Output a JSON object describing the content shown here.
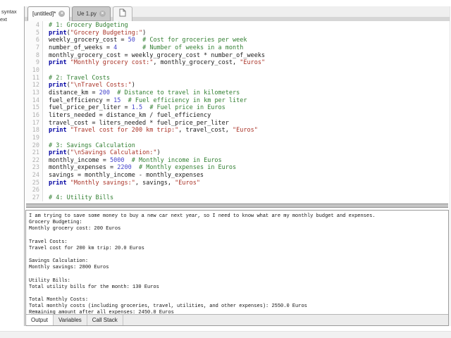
{
  "page": {
    "left_margin_labels": [
      "syntax",
      "ext"
    ]
  },
  "icons": {
    "close_glyph": "×"
  },
  "editor": {
    "tabs": [
      {
        "label": "[untitled]*",
        "active": true
      },
      {
        "label": "Ue 1.py",
        "active": false
      }
    ],
    "lines": [
      {
        "n": "4",
        "tokens": [
          [
            "c",
            "# 1: Grocery Budgeting"
          ]
        ]
      },
      {
        "n": "5",
        "tokens": [
          [
            "k",
            "print"
          ],
          [
            "p",
            "("
          ],
          [
            "s",
            "\"Grocery Budgeting:\""
          ],
          [
            "p",
            ")"
          ]
        ]
      },
      {
        "n": "6",
        "tokens": [
          [
            "p",
            "weekly_grocery_cost = "
          ],
          [
            "n",
            "50"
          ],
          [
            "p",
            "  "
          ],
          [
            "c",
            "# Cost for groceries per week"
          ]
        ]
      },
      {
        "n": "7",
        "tokens": [
          [
            "p",
            "number_of_weeks = "
          ],
          [
            "n",
            "4"
          ],
          [
            "p",
            "       "
          ],
          [
            "c",
            "# Number of weeks in a month"
          ]
        ]
      },
      {
        "n": "8",
        "tokens": [
          [
            "p",
            "monthly_grocery_cost = weekly_grocery_cost * number_of_weeks"
          ]
        ]
      },
      {
        "n": "9",
        "tokens": [
          [
            "k",
            "print"
          ],
          [
            "p",
            " "
          ],
          [
            "s",
            "\"Monthly grocery cost:\""
          ],
          [
            "p",
            ", monthly_grocery_cost, "
          ],
          [
            "s",
            "\"Euros\""
          ]
        ]
      },
      {
        "n": "10",
        "tokens": []
      },
      {
        "n": "11",
        "tokens": [
          [
            "c",
            "# 2: Travel Costs"
          ]
        ]
      },
      {
        "n": "12",
        "tokens": [
          [
            "k",
            "print"
          ],
          [
            "p",
            "("
          ],
          [
            "s",
            "\"\\nTravel Costs:\""
          ],
          [
            "p",
            ")"
          ]
        ]
      },
      {
        "n": "13",
        "tokens": [
          [
            "p",
            "distance_km = "
          ],
          [
            "n",
            "200"
          ],
          [
            "p",
            "  "
          ],
          [
            "c",
            "# Distance to travel in kilometers"
          ]
        ]
      },
      {
        "n": "14",
        "tokens": [
          [
            "p",
            "fuel_efficiency = "
          ],
          [
            "n",
            "15"
          ],
          [
            "p",
            "  "
          ],
          [
            "c",
            "# Fuel efficiency in km per liter"
          ]
        ]
      },
      {
        "n": "15",
        "tokens": [
          [
            "p",
            "fuel_price_per_liter = "
          ],
          [
            "n",
            "1.5"
          ],
          [
            "p",
            "  "
          ],
          [
            "c",
            "# Fuel price in Euros"
          ]
        ]
      },
      {
        "n": "16",
        "tokens": [
          [
            "p",
            "liters_needed = distance_km / fuel_efficiency"
          ]
        ]
      },
      {
        "n": "17",
        "tokens": [
          [
            "p",
            "travel_cost = liters_needed * fuel_price_per_liter"
          ]
        ]
      },
      {
        "n": "18",
        "tokens": [
          [
            "k",
            "print"
          ],
          [
            "p",
            " "
          ],
          [
            "s",
            "\"Travel cost for 200 km trip:\""
          ],
          [
            "p",
            ", travel_cost, "
          ],
          [
            "s",
            "\"Euros\""
          ]
        ]
      },
      {
        "n": "19",
        "tokens": []
      },
      {
        "n": "20",
        "tokens": [
          [
            "c",
            "# 3: Savings Calculation"
          ]
        ]
      },
      {
        "n": "21",
        "tokens": [
          [
            "k",
            "print"
          ],
          [
            "p",
            "("
          ],
          [
            "s",
            "\"\\nSavings Calculation:\""
          ],
          [
            "p",
            ")"
          ]
        ]
      },
      {
        "n": "22",
        "tokens": [
          [
            "p",
            "monthly_income = "
          ],
          [
            "n",
            "5000"
          ],
          [
            "p",
            "  "
          ],
          [
            "c",
            "# Monthly income in Euros"
          ]
        ]
      },
      {
        "n": "23",
        "tokens": [
          [
            "p",
            "monthly_expenses = "
          ],
          [
            "n",
            "2200"
          ],
          [
            "p",
            "  "
          ],
          [
            "c",
            "# Monthly expenses in Euros"
          ]
        ]
      },
      {
        "n": "24",
        "tokens": [
          [
            "p",
            "savings = monthly_income - monthly_expenses"
          ]
        ]
      },
      {
        "n": "25",
        "tokens": [
          [
            "k",
            "print"
          ],
          [
            "p",
            " "
          ],
          [
            "s",
            "\"Monthly savings:\""
          ],
          [
            "p",
            ", savings, "
          ],
          [
            "s",
            "\"Euros\""
          ]
        ]
      },
      {
        "n": "26",
        "tokens": []
      },
      {
        "n": "27",
        "tokens": [
          [
            "c",
            "# 4: Utility Bills"
          ]
        ]
      }
    ]
  },
  "output": {
    "lines": [
      "I am trying to save some money to buy a new car next year, so I need to know what are my monthly budget and expenses.",
      "Grocery Budgeting:",
      "Monthly grocery cost: 200 Euros",
      "",
      "Travel Costs:",
      "Travel cost for 200 km trip: 20.0 Euros",
      "",
      "Savings Calculation:",
      "Monthly savings: 2800 Euros",
      "",
      "Utility Bills:",
      "Total utility bills for the month: 130 Euros",
      "",
      "Total Monthly Costs:",
      "Total monthly costs (including groceries, travel, utilities, and other expenses): 2550.0 Euros",
      "Remaining amount after all expenses: 2450.0 Euros"
    ],
    "tabs": [
      "Output",
      "Variables",
      "Call Stack"
    ],
    "active_tab": "Output"
  },
  "colors": {
    "keyword": "#0000a2",
    "string": "#a93226",
    "comment": "#317f31",
    "number": "#4444cc",
    "tab_strip_bg": "#efefef",
    "inactive_tab_bg": "#c9c9c9",
    "panel_border": "#999999"
  }
}
